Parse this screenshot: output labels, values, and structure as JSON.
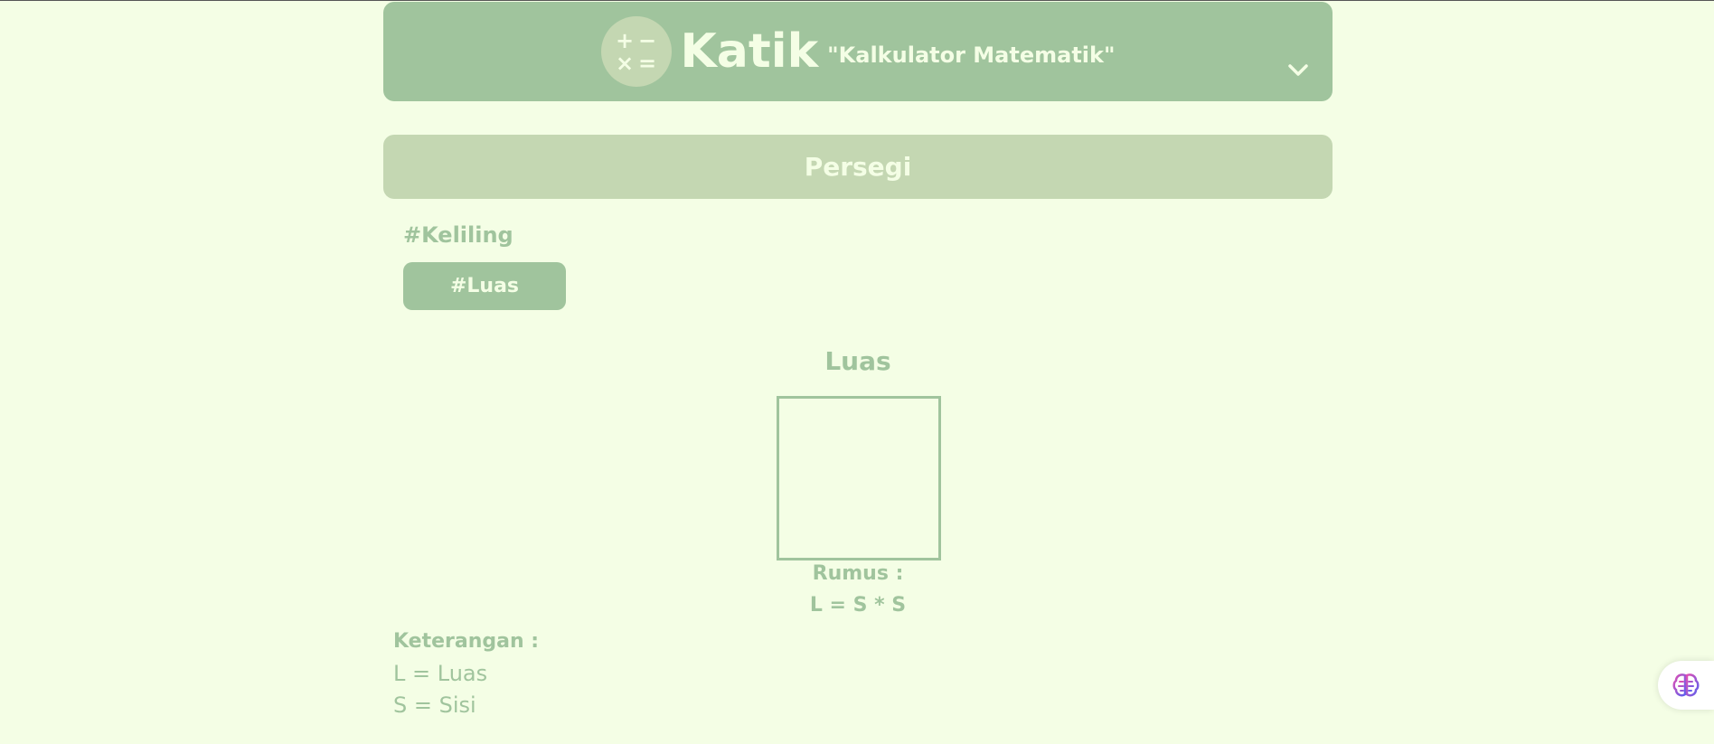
{
  "header": {
    "logo_symbols": [
      "+",
      "−",
      "×",
      "="
    ],
    "title": "Katik",
    "subtitle": "\"Kalkulator Matematik\"",
    "toggle_icon": "chevron-down-icon"
  },
  "shape": {
    "title": "Persegi"
  },
  "subnav": {
    "keliling_label": "#Keliling",
    "luas_label": "#Luas"
  },
  "section": {
    "title": "Luas",
    "rumus_label": "Rumus :",
    "rumus_formula": "L = S * S"
  },
  "keterangan": {
    "title": "Keterangan :",
    "lines": [
      "L = Luas",
      "S = Sisi"
    ]
  },
  "assistant": {
    "icon": "brain-icon"
  },
  "colors": {
    "background": "#f4fee5",
    "primary": "#a0c49d",
    "secondary": "#c4d7b2",
    "text_light": "#f4fee5"
  }
}
